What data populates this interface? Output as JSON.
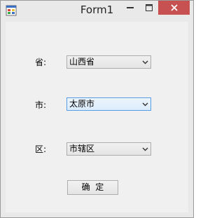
{
  "window": {
    "title": "Form1",
    "icon": "app-form-icon",
    "controls": {
      "minimize": "minimize-icon",
      "maximize": "maximize-icon",
      "close": "close-icon"
    }
  },
  "form": {
    "province": {
      "label": "省:",
      "value": "山西省"
    },
    "city": {
      "label": "市:",
      "value": "太原市"
    },
    "district": {
      "label": "区:",
      "value": "市辖区"
    },
    "ok_button": "确  定"
  },
  "colors": {
    "close_button": "#c75050",
    "focus_border": "#569de5"
  }
}
